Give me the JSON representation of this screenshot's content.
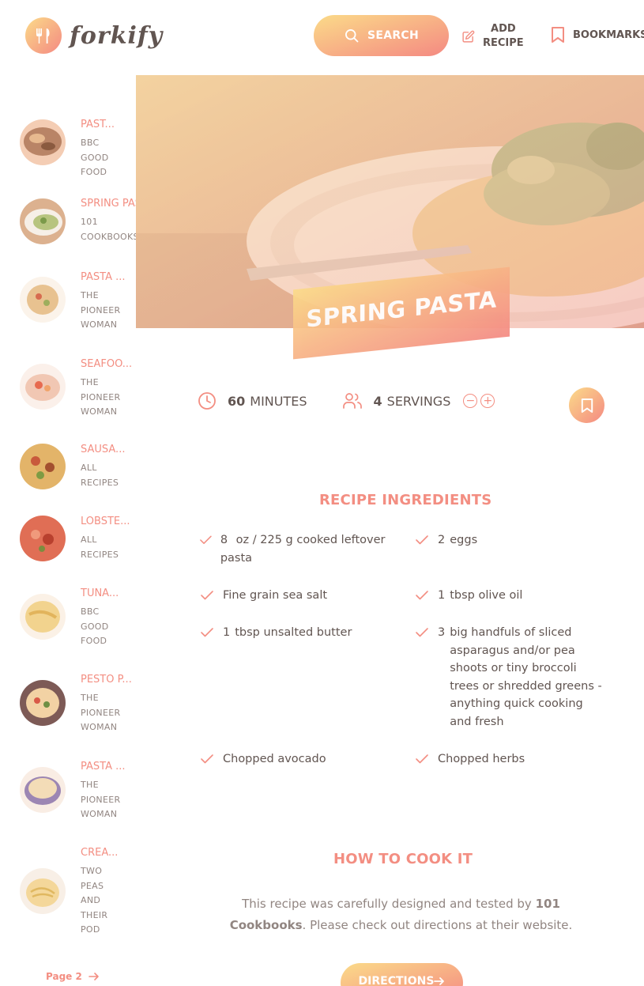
{
  "header": {
    "logo_text": "forkify",
    "search_label": "SEARCH",
    "add_recipe_line1": "ADD",
    "add_recipe_line2": "RECIPE",
    "bookmarks_label": "BOOKMARKS"
  },
  "results": [
    {
      "title": "PAST...",
      "publisher": "BBC GOOD FOOD"
    },
    {
      "title": "SPRING PASTA",
      "publisher": "101 COOKBOOKS"
    },
    {
      "title": "PASTA ...",
      "publisher": "THE PIONEER WOMAN"
    },
    {
      "title": "SEAFOO...",
      "publisher": "THE PIONEER WOMAN"
    },
    {
      "title": "SAUSA...",
      "publisher": "ALL RECIPES"
    },
    {
      "title": "LOBSTE...",
      "publisher": "ALL RECIPES"
    },
    {
      "title": "TUNA...",
      "publisher": "BBC GOOD FOOD"
    },
    {
      "title": "PESTO P...",
      "publisher": "THE PIONEER WOMAN"
    },
    {
      "title": "PASTA ...",
      "publisher": "THE PIONEER WOMAN"
    },
    {
      "title": "CREA...",
      "publisher": "TWO PEAS AND THEIR POD"
    }
  ],
  "pagination": {
    "next_label": "Page 2"
  },
  "recipe": {
    "title": "SPRING PASTA",
    "minutes": "60",
    "minutes_label": "MINUTES",
    "servings": "4",
    "servings_label": "SERVINGS",
    "ingredients_heading": "RECIPE INGREDIENTS",
    "ingredients": [
      {
        "qty": "8",
        "desc": "oz / 225 g cooked leftover pasta"
      },
      {
        "qty": "2",
        "desc": "eggs"
      },
      {
        "qty": "",
        "desc": "Fine grain sea salt"
      },
      {
        "qty": "1",
        "desc": "tbsp olive oil"
      },
      {
        "qty": "1",
        "desc": "tbsp unsalted butter"
      },
      {
        "qty": "3",
        "desc": "big handfuls of sliced asparagus and/or pea shoots or tiny broccoli trees or shredded greens - anything quick cooking and fresh"
      },
      {
        "qty": "",
        "desc": "Chopped avocado"
      },
      {
        "qty": "",
        "desc": "Chopped herbs"
      }
    ],
    "directions_heading": "HOW TO COOK IT",
    "directions_text_1": "This recipe was carefully designed and tested by",
    "publisher": "101 Cookbooks",
    "directions_text_2": ". Please check out directions at their website.",
    "directions_button": "DIRECTIONS"
  },
  "colors": {
    "accent": "#f38e82",
    "gradient_start": "#fbdb89",
    "gradient_end": "#f48982",
    "text": "#615551"
  }
}
